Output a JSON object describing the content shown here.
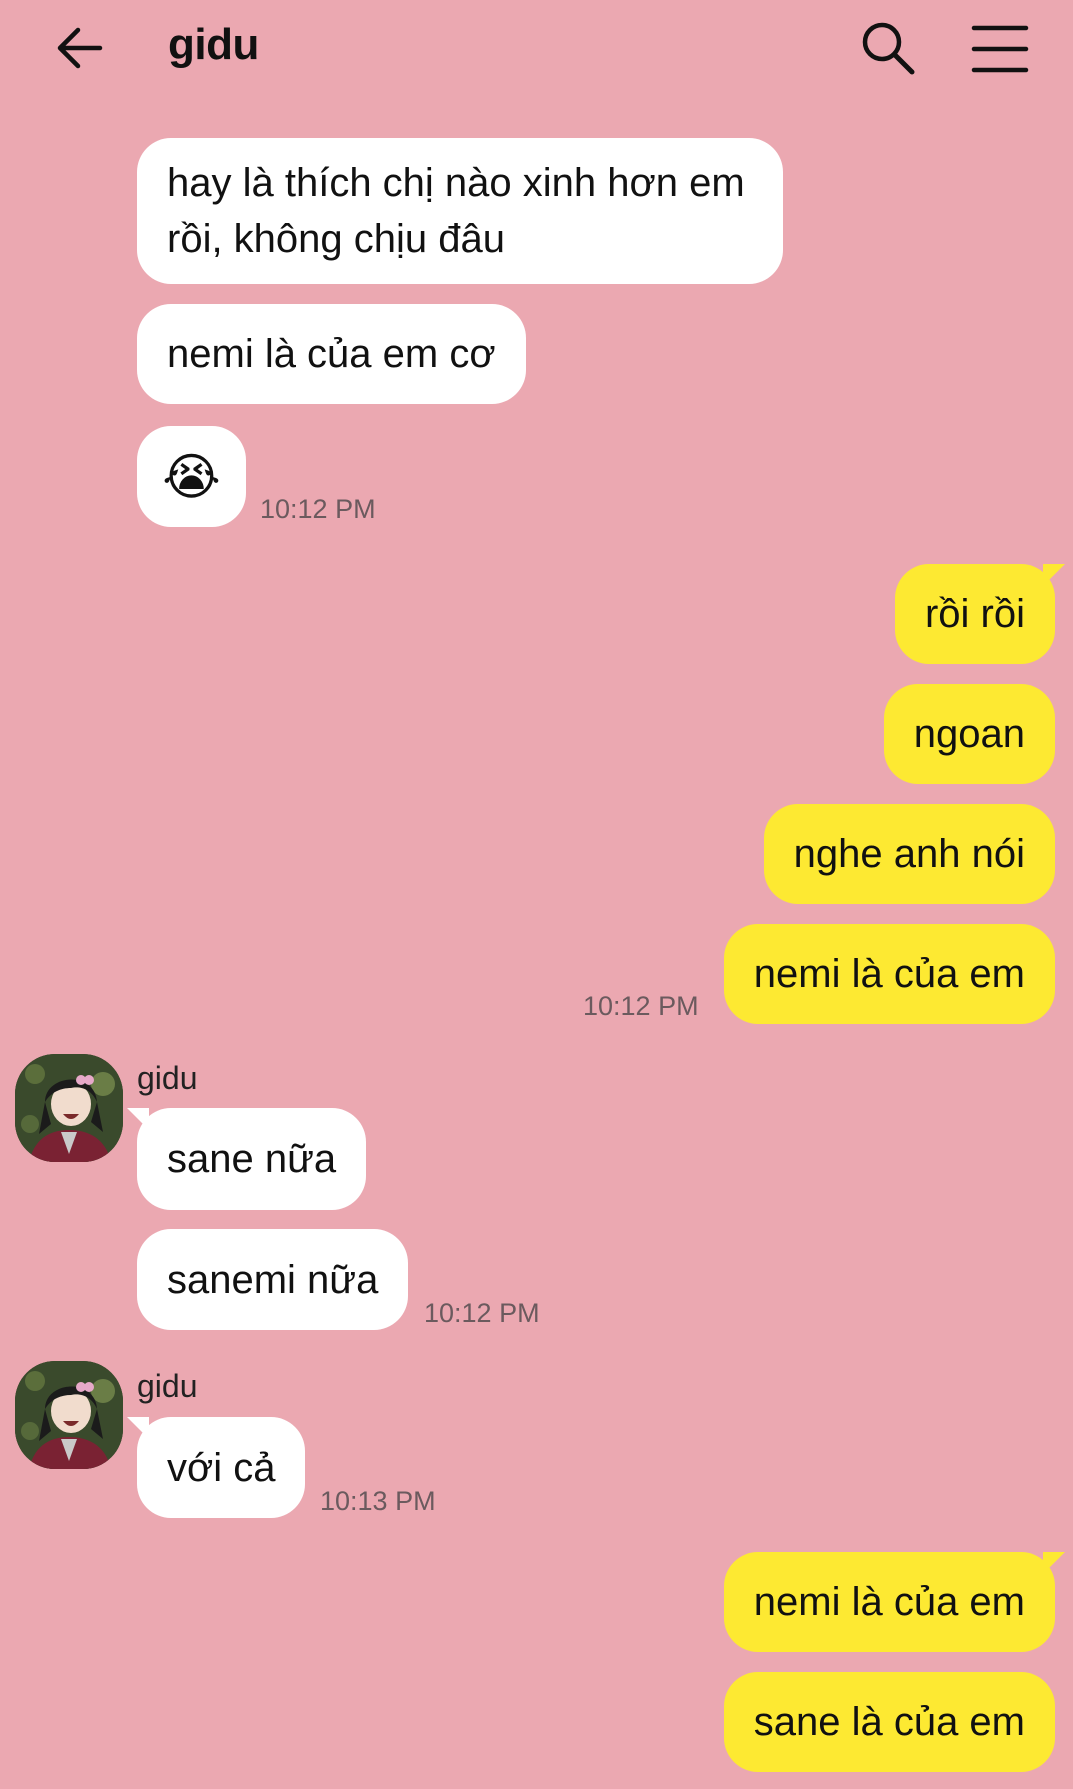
{
  "header": {
    "title": "gidu"
  },
  "messages": {
    "m1": "hay là thích chị nào xinh hơn em rồi, không chịu đâu",
    "m2": "nemi là của em cơ",
    "m3": "😭",
    "t1": "10:12 PM",
    "o1": "rồi rồi",
    "o2": "ngoan",
    "o3": "nghe anh nói",
    "o4": "nemi là của em",
    "t2": "10:12 PM",
    "s1": "gidu",
    "m4": "sane nữa",
    "m5": "sanemi nữa",
    "t3": "10:12 PM",
    "s2": "gidu",
    "m6": "với cả",
    "t4": "10:13 PM",
    "o5": "nemi là của em",
    "o6": "sane là của em"
  },
  "colors": {
    "background": "#eba8b1",
    "incoming_bubble": "#ffffff",
    "outgoing_bubble": "#fde932"
  },
  "icons": [
    "back-arrow-icon",
    "search-icon",
    "menu-icon",
    "avatar"
  ]
}
